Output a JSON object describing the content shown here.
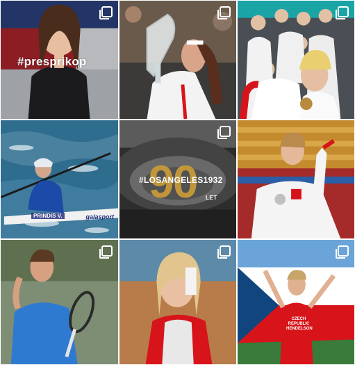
{
  "feed": {
    "tiles": [
      {
        "id": "tile-1",
        "hashtag": "#presprikop",
        "multi": true
      },
      {
        "id": "tile-2",
        "multi": true
      },
      {
        "id": "tile-3",
        "multi": true
      },
      {
        "id": "tile-4",
        "boat_label": "PRINDIS V.",
        "boat_brand": "galasport",
        "multi": false
      },
      {
        "id": "tile-5",
        "hashtag": "#LOSANGELES1932",
        "number": "90",
        "sub": "LET",
        "multi": true
      },
      {
        "id": "tile-6",
        "multi": false
      },
      {
        "id": "tile-7",
        "multi": true
      },
      {
        "id": "tile-8",
        "multi": true
      },
      {
        "id": "tile-9",
        "bib": "CZECH REPUBLIC\nHENDELSON",
        "multi": true
      }
    ]
  },
  "colors": {
    "gold": "#c79a3a",
    "czech_red": "#d7141a",
    "czech_blue": "#11457e",
    "white": "#ffffff"
  },
  "icons": {
    "multi_post": "carousel-icon"
  }
}
